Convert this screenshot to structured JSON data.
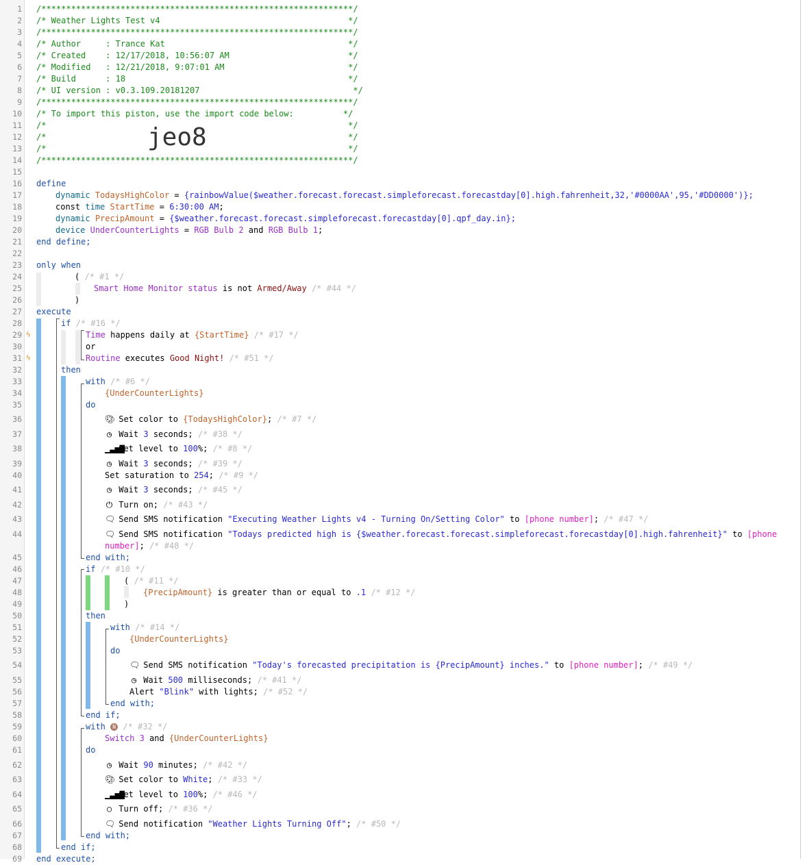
{
  "header": {
    "border": "/***************************************************************/",
    "title_line": "/* Weather Lights Test v4                                      */",
    "author_line": "/* Author     : Trance Kat                                     */",
    "created_line": "/* Created    : 12/17/2018, 10:56:07 AM                        */",
    "modified_line": "/* Modified   : 12/21/2018, 9:07:01 AM                         */",
    "build_line": "/* Build      : 18                                             */",
    "ui_line": "/* UI version : v0.3.109.20181207                               */",
    "import_line": "/* To import this piston, use the import code below:          */",
    "blank_line": "/*                                                             */",
    "import_code": "jeo8"
  },
  "line_numbers": [
    "1",
    "2",
    "3",
    "4",
    "5",
    "6",
    "7",
    "8",
    "9",
    "10",
    "11",
    "12",
    "13",
    "14",
    "15",
    "16",
    "17",
    "18",
    "19",
    "20",
    "21",
    "22",
    "23",
    "24",
    "25",
    "26",
    "27",
    "28",
    "29",
    "30",
    "31",
    "32",
    "33",
    "34",
    "35",
    "36",
    "37",
    "38",
    "39",
    "40",
    "41",
    "42",
    "43",
    "44",
    "45",
    "46",
    "47",
    "48",
    "49",
    "50",
    "51",
    "52",
    "53",
    "54",
    "55",
    "56",
    "57",
    "58",
    "59",
    "60",
    "61",
    "62",
    "63",
    "64",
    "65",
    "66",
    "67",
    "68",
    "69"
  ],
  "t": {
    "define": "define",
    "end_define": "end define;",
    "dynamic": "dynamic",
    "const": "const",
    "time": "time",
    "device": "device",
    "v_thc": "TodaysHighColor",
    "v_st": "StartTime",
    "v_pa": "PrecipAmount",
    "v_ucl": "UnderCounterLights",
    "eq": " = ",
    "thc_expr": "{rainbowValue($weather.forecast.forecast.simpleforecast.forecastday[0].high.fahrenheit,32,'#0000AA',95,'#DD0000')};",
    "st_val": "6:30:00 AM",
    "semi": ";",
    "pa_expr": "{$weather.forecast.forecast.simpleforecast.forecastday[0].qpf_day.in};",
    "rgb2": "RGB Bulb 2",
    "and": " and ",
    "rgb1": "RGB Bulb 1",
    "only_when": "only when",
    "lp": "(",
    "rp": ")",
    "c1": "/* #1 */",
    "shm": "Smart Home Monitor",
    "status": " status",
    "is_not": " is not ",
    "armed": "Armed/Away",
    "c44": "/* #44 */",
    "execute": "execute",
    "if": "if",
    "c16": "/* #16 */",
    "time_cap": "Time",
    "happens": " happens daily at ",
    "st_ref": "{StartTime}",
    "c17": "/* #17 */",
    "or": "or",
    "routine": "Routine",
    "executes": " executes ",
    "goodnight": "Good Night!",
    "c51": "/* #51 */",
    "then": "then",
    "with": "with",
    "c6": "/* #6 */",
    "ucl_ref": "{UnderCounterLights}",
    "do": "do",
    "set_color_to": "Set color to ",
    "thc_ref": "{TodaysHighColor}",
    "c7": "/* #7 */",
    "wait": "Wait ",
    "three": "3",
    "seconds": " seconds;",
    "c38": "/* #38 */",
    "set_level_to": "Set level to ",
    "hundred": "100",
    "pct": "%;",
    "c8": "/* #8 */",
    "c39": "/* #39 */",
    "set_sat": "Set saturation to ",
    "n254": "254",
    "c9": "/* #9 */",
    "c45": "/* #45 */",
    "turn_on": "Turn on;",
    "c43": "/* #43 */",
    "send_sms": "Send SMS notification ",
    "sms1": "\"Executing Weather Lights v4 - Turning On/Setting Color\"",
    "to": " to ",
    "phone": "[phone number]",
    "c47": "/* #47 */",
    "sms2": "\"Todays predicted high is {$weather.forecast.forecast.simpleforecast.forecastday[0].high.fahrenheit}\"",
    "phone_a": "[phone",
    "phone_b": "number]",
    "c48": "/* #48 */",
    "end_with": "end with;",
    "c10": "/* #10 */",
    "c11": "/* #11 */",
    "pa_ref": "{PrecipAmount}",
    "gte": " is greater than or equal to ",
    "p1": ".1",
    "c12": "/* #12 */",
    "c14": "/* #14 */",
    "sms3": "\"Today's forecasted precipitation is {PrecipAmount} inches.\"",
    "c49": "/* #49 */",
    "n500": "500",
    "ms": " milliseconds;",
    "c41": "/* #41 */",
    "alert": "Alert ",
    "blink": "\"Blink\"",
    "with_lights": " with lights;",
    "c52": "/* #52 */",
    "end_if": "end if;",
    "badge": "N",
    "c32": "/* #32 */",
    "switch3": "Switch 3",
    "n90": "90",
    "minutes": " minutes;",
    "c42": "/* #42 */",
    "white": "White",
    "c33": "/* #33 */",
    "c46": "/* #46 */",
    "turn_off": "Turn off;",
    "c36": "/* #36 */",
    "send_notif": "Send notification ",
    "notif": "\"Weather Lights Turning Off\"",
    "c50": "/* #50 */",
    "end_execute": "end execute;"
  }
}
